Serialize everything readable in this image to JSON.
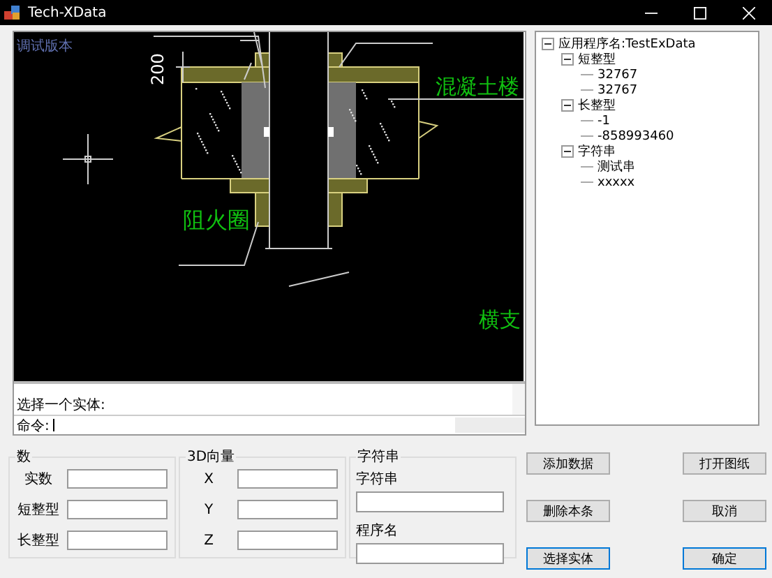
{
  "window": {
    "title": "Tech-XData"
  },
  "canvas": {
    "labels": [
      {
        "kind": "watermark",
        "text": "调试版本"
      },
      {
        "kind": "dimension",
        "text": "200"
      },
      {
        "kind": "concrete",
        "text": "混凝土楼"
      },
      {
        "kind": "firestop",
        "text": "阻火圈"
      },
      {
        "kind": "branch",
        "text": "横支"
      }
    ]
  },
  "command": {
    "history": "选择一个实体:",
    "prompt": "命令:"
  },
  "tree": [
    {
      "label": "应用程序名:TestExData",
      "expanded": true,
      "children": [
        {
          "label": "短整型",
          "expanded": true,
          "children": [
            {
              "label": "32767"
            },
            {
              "label": "32767"
            }
          ]
        },
        {
          "label": "长整型",
          "expanded": true,
          "children": [
            {
              "label": "-1"
            },
            {
              "label": "-858993460"
            }
          ]
        },
        {
          "label": "字符串",
          "expanded": true,
          "children": [
            {
              "label": "测试串"
            },
            {
              "label": "xxxxx"
            }
          ]
        }
      ]
    }
  ],
  "groups": [
    {
      "kind": "inline",
      "title": "数",
      "fields": [
        {
          "label": "实数"
        },
        {
          "label": "短整型"
        },
        {
          "label": "长整型"
        }
      ]
    },
    {
      "kind": "inline",
      "title": "3D向量",
      "fields": [
        {
          "label": "X"
        },
        {
          "label": "Y"
        },
        {
          "label": "Z"
        }
      ]
    },
    {
      "kind": "stacked",
      "title": "字符串",
      "fields": [
        {
          "label": "字符串"
        },
        {
          "label": "程序名"
        }
      ]
    }
  ],
  "buttons": [
    {
      "label": "添加数据",
      "default": false
    },
    {
      "label": "打开图纸",
      "default": false
    },
    {
      "label": "删除本条",
      "default": false
    },
    {
      "label": "取消",
      "default": false
    },
    {
      "label": "选择实体",
      "default": true
    },
    {
      "label": "确定",
      "default": true
    }
  ]
}
